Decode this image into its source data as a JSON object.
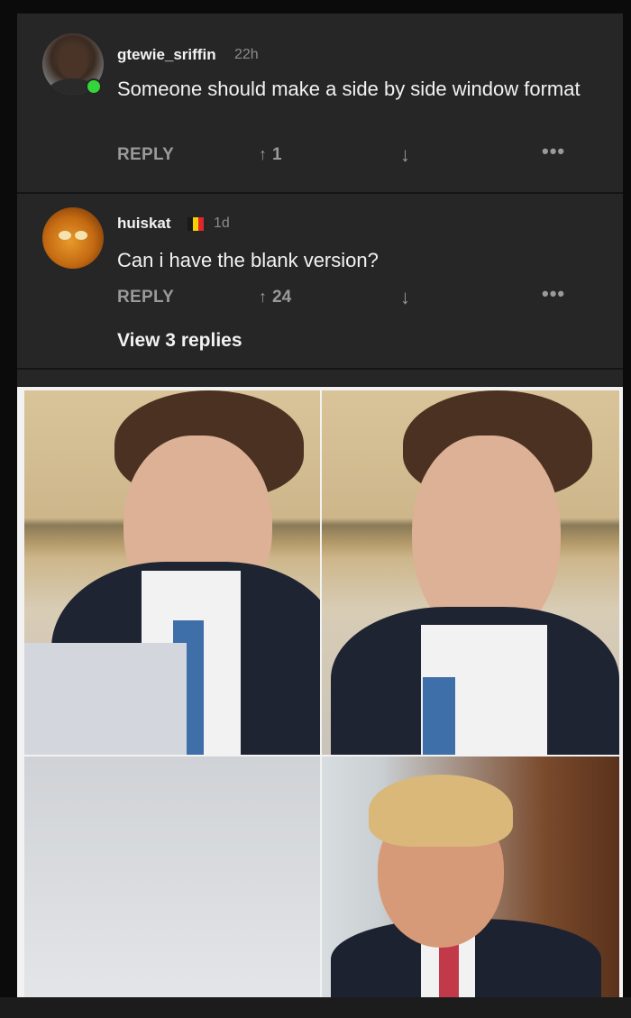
{
  "comments": [
    {
      "username": "gtewie_sriffin",
      "time": "22h",
      "text": "Someone should make a side by side window format",
      "reply_label": "REPLY",
      "upvotes": "1",
      "online": true
    },
    {
      "username": "huiskat",
      "time": "1d",
      "text": "Can i have the blank version?",
      "reply_label": "REPLY",
      "upvotes": "24",
      "view_replies": "View 3 replies",
      "flag_colors": [
        "#1a1a1a",
        "#f5d000",
        "#e0262b"
      ]
    }
  ],
  "icons": {
    "upvote": "↑",
    "downvote": "↓",
    "more": "•••"
  },
  "colors": {
    "background": "#0b0b0b",
    "card": "#262626",
    "muted": "#9a9a9a",
    "online": "#35d43a"
  }
}
